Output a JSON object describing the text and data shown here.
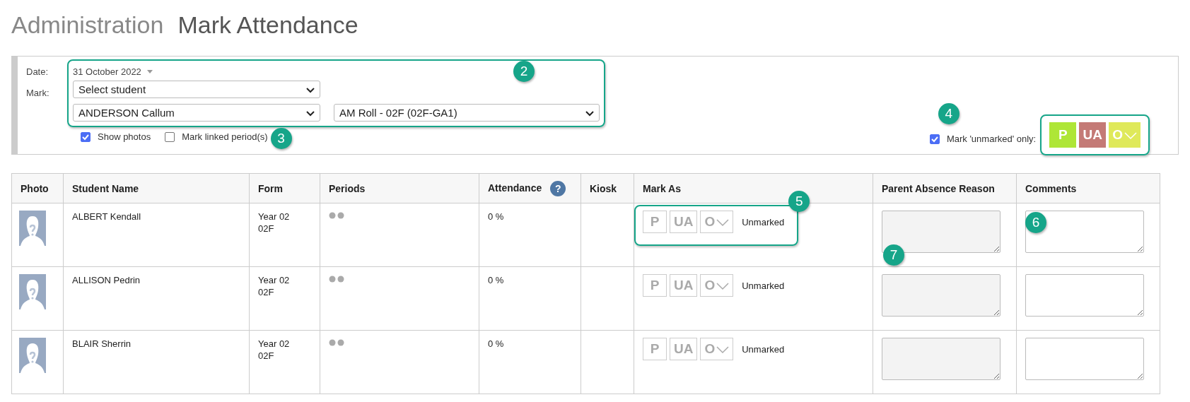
{
  "title": {
    "section": "Administration",
    "page": "Mark Attendance"
  },
  "filters": {
    "date_label": "Date:",
    "date_value": "31 October 2022",
    "mark_label": "Mark:",
    "student_select": "Select student",
    "student_value": "ANDERSON Callum",
    "roll_value": "AM Roll - 02F (02F-GA1)",
    "selection_callout": "2",
    "show_photos": {
      "label": "Show photos",
      "checked": true
    },
    "mark_linked": {
      "label": "Mark linked period(s)",
      "checked": false
    },
    "linked_callout": "3",
    "unmarked_only": {
      "label": "Mark 'unmarked' only:",
      "checked": true
    },
    "bulk_callout": "4",
    "bulk_marks": [
      {
        "code": "P",
        "color": "#aee637",
        "dropdown": false
      },
      {
        "code": "UA",
        "color": "#c47a76",
        "dropdown": false
      },
      {
        "code": "O",
        "color": "#dfe95a",
        "dropdown": true
      }
    ]
  },
  "table": {
    "columns": [
      {
        "label": "Photo"
      },
      {
        "label": "Student Name"
      },
      {
        "label": "Form"
      },
      {
        "label": "Periods"
      },
      {
        "label": "Attendance",
        "help": "?"
      },
      {
        "label": "Kiosk"
      },
      {
        "label": "Mark As"
      },
      {
        "label": "Parent Absence Reason"
      },
      {
        "label": "Comments"
      }
    ],
    "rows": [
      {
        "name": "ALBERT Kendall",
        "form": [
          "Year 02",
          "02F"
        ],
        "attendance": "0 %",
        "marks": [
          {
            "code": "P",
            "selected": false,
            "dropdown": false
          },
          {
            "code": "UA",
            "selected": false,
            "dropdown": false
          },
          {
            "code": "O",
            "selected": false,
            "dropdown": true
          }
        ],
        "status": "Unmarked",
        "mark_callout": "5",
        "reason_callout": "7",
        "comments_callout": "6"
      },
      {
        "name": "ALLISON Pedrin",
        "form": [
          "Year 02",
          "02F"
        ],
        "attendance": "0 %",
        "marks": [
          {
            "code": "P",
            "selected": false,
            "dropdown": false
          },
          {
            "code": "UA",
            "selected": false,
            "dropdown": false
          },
          {
            "code": "O",
            "selected": false,
            "dropdown": true
          }
        ],
        "status": "Unmarked"
      },
      {
        "name": "BLAIR Sherrin",
        "form": [
          "Year 02",
          "02F"
        ],
        "attendance": "0 %",
        "marks": [
          {
            "code": "P",
            "selected": false,
            "dropdown": false
          },
          {
            "code": "UA",
            "selected": false,
            "dropdown": false
          },
          {
            "code": "O",
            "selected": false,
            "dropdown": true
          }
        ],
        "status": "Unmarked"
      }
    ]
  }
}
